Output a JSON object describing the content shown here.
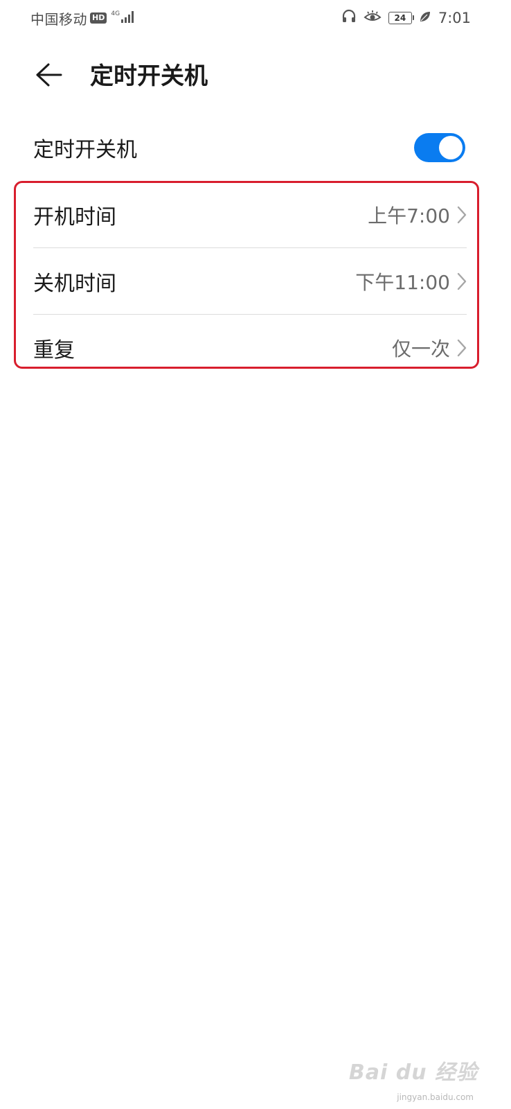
{
  "status_bar": {
    "carrier": "中国移动",
    "hd_badge": "HD",
    "network_type": "4G",
    "battery_level": "24",
    "time": "7:01",
    "icons": [
      "signal-icon",
      "headset-icon",
      "eye-comfort-icon",
      "battery-icon",
      "leaf-icon"
    ]
  },
  "header": {
    "title": "定时开关机",
    "back_icon": "arrow-left-icon"
  },
  "master_toggle": {
    "label": "定时开关机",
    "enabled": true,
    "accent_color": "#0a7cf0"
  },
  "settings": [
    {
      "label": "开机时间",
      "value": "上午7:00"
    },
    {
      "label": "关机时间",
      "value": "下午11:00"
    },
    {
      "label": "重复",
      "value": "仅一次"
    }
  ],
  "annotation": {
    "color": "#d81e2d"
  },
  "watermark": {
    "text": "Bai du 经验",
    "sub": "jingyan.baidu.com"
  }
}
